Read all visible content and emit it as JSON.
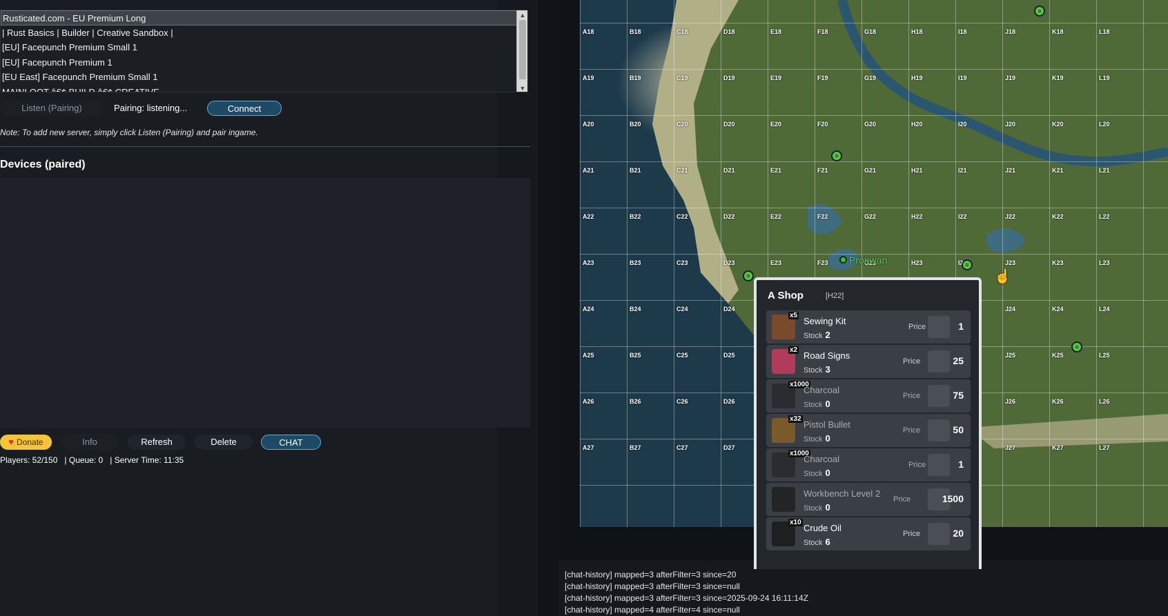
{
  "servers": {
    "items": [
      "Rusticated.com - EU Premium Long",
      "| Rust Basics | Builder | Creative Sandbox |",
      "[EU] Facepunch Premium Small 1",
      "[EU] Facepunch Premium 1",
      "[EU East] Facepunch Premium Small 1",
      "MAINLOOT â€¢ BUILD â€¢ CREATIVE"
    ]
  },
  "pairing": {
    "listen_label": "Listen (Pairing)",
    "status": "Pairing: listening...",
    "connect_label": "Connect",
    "note": "Note: To add new server, simply click Listen (Pairing) and pair ingame."
  },
  "devices": {
    "title": "Devices (paired)"
  },
  "actions": {
    "donate_label": "Donate",
    "info_label": "Info",
    "refresh_label": "Refresh",
    "delete_label": "Delete",
    "chat_label": "CHAT"
  },
  "status": {
    "players": "Players: 52/150",
    "queue": "| Queue: 0",
    "server_time": "| Server Time: 11:35"
  },
  "map": {
    "columns": [
      "A",
      "B",
      "C",
      "D",
      "E",
      "F",
      "G",
      "H",
      "I",
      "J",
      "K",
      "L"
    ],
    "rows": [
      18,
      19,
      20,
      21,
      22,
      23,
      24,
      25,
      26,
      27
    ],
    "player_name": "Pronwan"
  },
  "shop": {
    "title": "A Shop",
    "grid": "[H22]",
    "price_label": "Price",
    "stock_label": "Stock",
    "items": [
      {
        "qty": "x5",
        "name": "Sewing Kit",
        "stock": "2",
        "price": "1",
        "color": "#7b4a2a"
      },
      {
        "qty": "x2",
        "name": "Road Signs",
        "stock": "3",
        "price": "25",
        "color": "#b13b5a"
      },
      {
        "qty": "x1000",
        "name": "Charcoal",
        "stock": "0",
        "price": "75",
        "color": "#2a2c2f"
      },
      {
        "qty": "x32",
        "name": "Pistol Bullet",
        "stock": "0",
        "price": "50",
        "color": "#7a5a2a"
      },
      {
        "qty": "x1000",
        "name": "Charcoal",
        "stock": "0",
        "price": "1",
        "color": "#2a2c2f"
      },
      {
        "qty": "",
        "name": "Workbench Level 2",
        "stock": "0",
        "price": "1500",
        "color": "#222426"
      },
      {
        "qty": "x10",
        "name": "Crude Oil",
        "stock": "6",
        "price": "20",
        "color": "#1d1f21"
      }
    ]
  },
  "console": {
    "lines": [
      "[chat-history] mapped=3 afterFilter=3 since=20",
      "[chat-history] mapped=3 afterFilter=3 since=null",
      "[chat-history] mapped=3 afterFilter=3 since=2025-09-24 16:11:14Z",
      "[chat-history] mapped=4 afterFilter=4 since=null"
    ]
  }
}
